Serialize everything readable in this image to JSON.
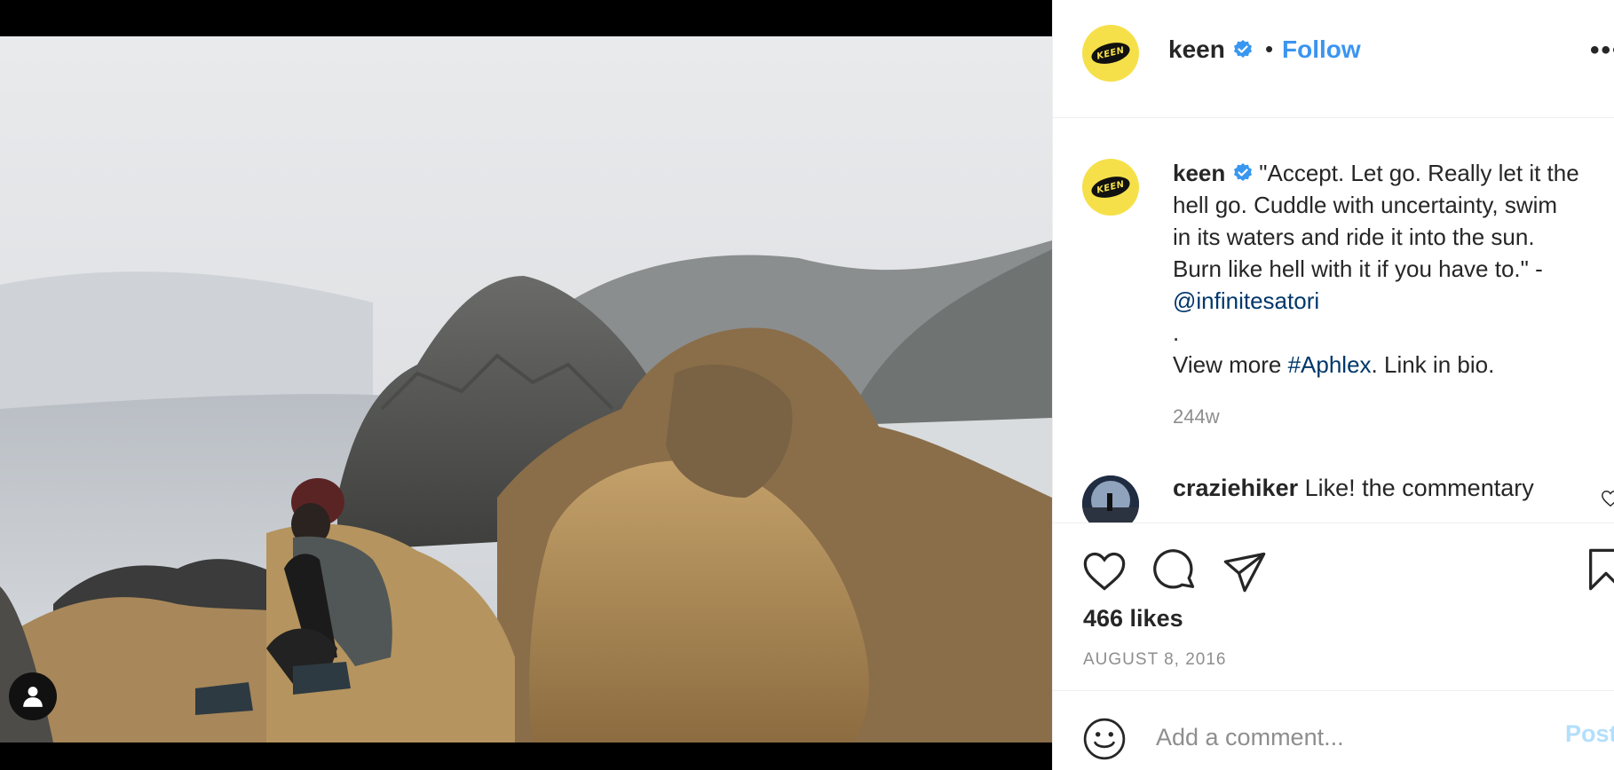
{
  "post": {
    "username": "keen",
    "follow_label": "Follow",
    "dot": "•",
    "more_label": "•••",
    "avatar_logo_text": "KEEN",
    "media_alt": "Person sitting on coastal rocks by the ocean with foggy hills"
  },
  "caption": {
    "username": "keen",
    "line1": "\"Accept. Let go. Really let it the",
    "line2": "hell go. Cuddle with uncertainty, swim",
    "line3": "in its waters and ride it into the sun.",
    "line4": "Burn like hell with it if you have to.\" -",
    "mention": "@infinitesatori",
    "dot_line": ".",
    "view_more_prefix": "View more ",
    "hashtag": "#Aphlex",
    "view_more_suffix": ". Link in bio.",
    "age": "244w"
  },
  "comment": {
    "username": "craziehiker",
    "text": "Like! the commentary"
  },
  "stats": {
    "likes": "466 likes",
    "date": "AUGUST 8, 2016"
  },
  "add_comment": {
    "placeholder": "Add a comment...",
    "post_label": "Post"
  },
  "icons": {
    "header_more": "more-options-icon",
    "verified": "verified-badge-icon",
    "like": "heart-icon",
    "comment": "comment-icon",
    "share": "paper-plane-icon",
    "save": "bookmark-icon",
    "emoji": "smiley-icon",
    "user_tag": "person-icon"
  },
  "colors": {
    "accent": "#0095f6",
    "follow": "#3b95f0",
    "verified": "#3897f0",
    "link": "#00376b",
    "post_disabled": "#b2dffc",
    "avatar_yellow": "#f6e04a"
  }
}
